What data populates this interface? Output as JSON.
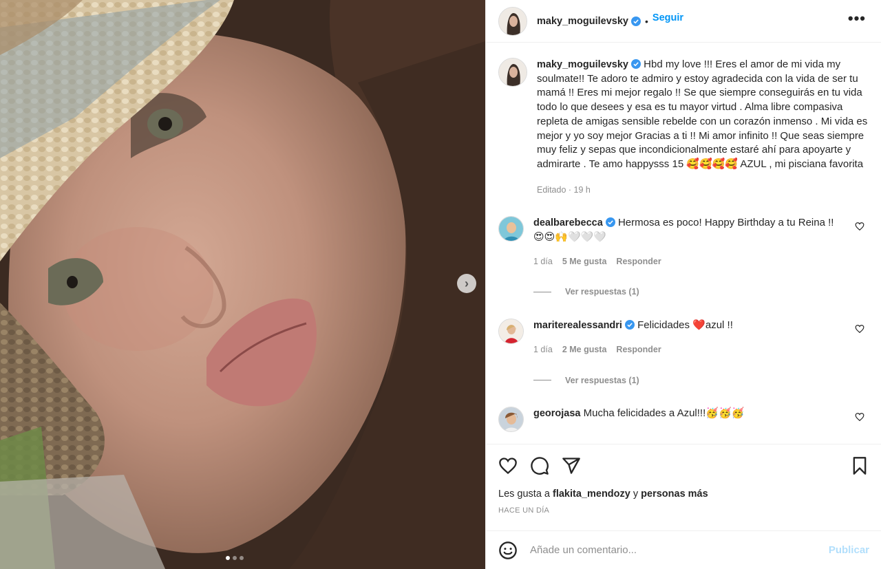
{
  "post": {
    "author": "maky_moguilevsky",
    "follow_label": "Seguir",
    "bullet": "•",
    "more_label": "•••",
    "caption": "Hbd my love !!! Eres el amor de mi vida my soulmate!! Te adoro te admiro y estoy agradecida con la vida de ser tu mamá !! Eres mi mejor regalo !! Se que siempre conseguirás en tu vida todo lo que desees y esa es tu mayor virtud . Alma libre compasiva repleta de amigas sensible rebelde con un corazón inmenso . Mi vida es mejor y yo soy mejor Gracias a ti !! Mi amor infinito !! Que seas siempre muy feliz y sepas que incondicionalmente estaré ahí para apoyarte y admirarte . Te amo happysss 15 🥰🥰🥰🥰 AZUL , mi pisciana favorita",
    "caption_meta": "Editado · 19 h",
    "carousel_next": "›"
  },
  "comments": [
    {
      "user": "dealbarebecca",
      "verified": true,
      "text": "Hermosa es poco! Happy Birthday a tu Reina !! 😍😍🙌🤍🤍🤍",
      "time": "1 día",
      "likes": "5 Me gusta",
      "reply": "Responder",
      "view_replies": "Ver respuestas (1)"
    },
    {
      "user": "mariterealessandri",
      "verified": true,
      "text": "Felicidades ❤️azul !!",
      "time": "1 día",
      "likes": "2 Me gusta",
      "reply": "Responder",
      "view_replies": "Ver respuestas (1)"
    },
    {
      "user": "georojasa",
      "verified": false,
      "text": "Mucha felicidades a Azul!!!🥳🥳🥳"
    }
  ],
  "likes": {
    "prefix": "Les gusta a",
    "user": "flakita_mendozy",
    "joiner": "y",
    "suffix": "personas más"
  },
  "timestamp": "HACE UN DÍA",
  "add_comment": {
    "placeholder": "Añade un comentario...",
    "publish_label": "Publicar"
  },
  "colors": {
    "accent": "#0095f6",
    "verified": "#3897f0",
    "publish_disabled": "#b2dffc",
    "muted": "#8e8e8e"
  },
  "icons": [
    "verified-badge-icon",
    "more-icon",
    "chevron-right-icon",
    "heart-icon",
    "comment-icon",
    "share-icon",
    "bookmark-icon",
    "emoji-icon"
  ]
}
